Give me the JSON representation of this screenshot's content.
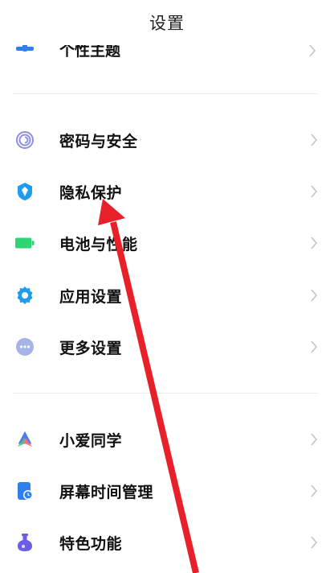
{
  "header": {
    "title": "设置"
  },
  "clipped_item": {
    "label": "个性主题",
    "icon": "theme-icon"
  },
  "group1": [
    {
      "label": "密码与安全",
      "icon": "fingerprint-icon",
      "color": "#8f8ee6"
    },
    {
      "label": "隐私保护",
      "icon": "shield-icon",
      "color": "#1e9cf0"
    },
    {
      "label": "电池与性能",
      "icon": "battery-icon",
      "color": "#2ed573"
    },
    {
      "label": "应用设置",
      "icon": "gear-icon",
      "color": "#1e9cf0"
    },
    {
      "label": "更多设置",
      "icon": "more-icon",
      "color": "#a5b3e6"
    }
  ],
  "group2": [
    {
      "label": "小爱同学",
      "icon": "xiaoai-icon",
      "color": "#4b7bec"
    },
    {
      "label": "屏幕时间管理",
      "icon": "screen-time-icon",
      "color": "#2f80ed"
    },
    {
      "label": "特色功能",
      "icon": "flask-icon",
      "color": "#6c5ce7"
    }
  ],
  "annotation": {
    "color": "#e8202a"
  }
}
